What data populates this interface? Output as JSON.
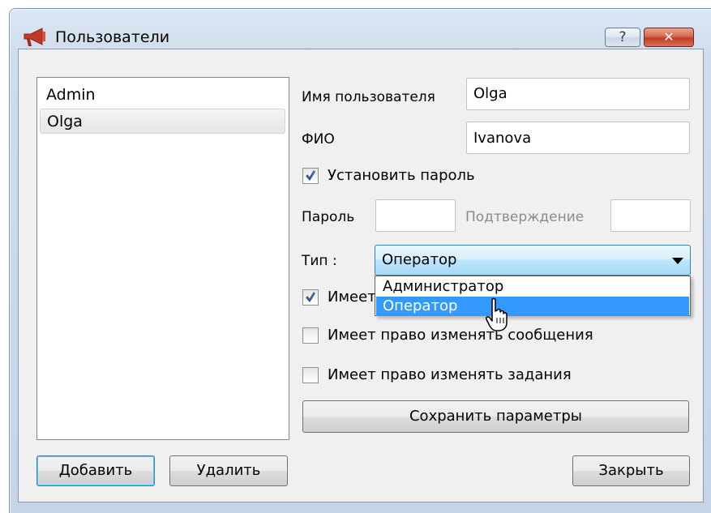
{
  "window": {
    "title": "Пользователи",
    "help_label": "?",
    "close_label": "✕"
  },
  "users": [
    "Admin",
    "Olga"
  ],
  "form": {
    "username_label": "Имя пользователя",
    "username_value": "Olga",
    "fullname_label": "ФИО",
    "fullname_value": "Ivanova",
    "set_password_label": "Установить пароль",
    "set_password_checked": true,
    "password_label": "Пароль",
    "password_value": "",
    "confirm_label": "Подтверждение",
    "confirm_value": "",
    "type_label": "Тип :",
    "type_selected": "Оператор",
    "type_options": [
      "Администратор",
      "Оператор"
    ],
    "perm1_label": "Имеет",
    "perm1_checked": true,
    "perm2_label": "Имеет право изменять сообщения",
    "perm2_checked": false,
    "perm3_label": "Имеет право изменять задания",
    "perm3_checked": false,
    "save_label": "Сохранить параметры"
  },
  "buttons": {
    "add_label": "Добавить",
    "delete_label": "Удалить",
    "close_label": "Закрыть"
  },
  "colors": {
    "selection": "#3399ff",
    "combo_border": "#3c7fb1",
    "close_button": "#c23d23"
  }
}
